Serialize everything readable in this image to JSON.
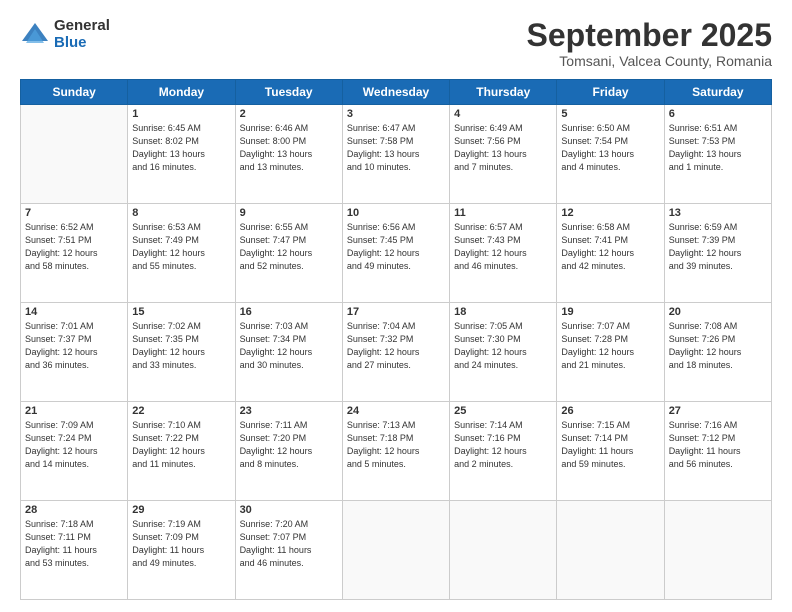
{
  "logo": {
    "general": "General",
    "blue": "Blue"
  },
  "header": {
    "month": "September 2025",
    "location": "Tomsani, Valcea County, Romania"
  },
  "weekdays": [
    "Sunday",
    "Monday",
    "Tuesday",
    "Wednesday",
    "Thursday",
    "Friday",
    "Saturday"
  ],
  "weeks": [
    [
      {
        "day": "",
        "info": ""
      },
      {
        "day": "1",
        "info": "Sunrise: 6:45 AM\nSunset: 8:02 PM\nDaylight: 13 hours\nand 16 minutes."
      },
      {
        "day": "2",
        "info": "Sunrise: 6:46 AM\nSunset: 8:00 PM\nDaylight: 13 hours\nand 13 minutes."
      },
      {
        "day": "3",
        "info": "Sunrise: 6:47 AM\nSunset: 7:58 PM\nDaylight: 13 hours\nand 10 minutes."
      },
      {
        "day": "4",
        "info": "Sunrise: 6:49 AM\nSunset: 7:56 PM\nDaylight: 13 hours\nand 7 minutes."
      },
      {
        "day": "5",
        "info": "Sunrise: 6:50 AM\nSunset: 7:54 PM\nDaylight: 13 hours\nand 4 minutes."
      },
      {
        "day": "6",
        "info": "Sunrise: 6:51 AM\nSunset: 7:53 PM\nDaylight: 13 hours\nand 1 minute."
      }
    ],
    [
      {
        "day": "7",
        "info": "Sunrise: 6:52 AM\nSunset: 7:51 PM\nDaylight: 12 hours\nand 58 minutes."
      },
      {
        "day": "8",
        "info": "Sunrise: 6:53 AM\nSunset: 7:49 PM\nDaylight: 12 hours\nand 55 minutes."
      },
      {
        "day": "9",
        "info": "Sunrise: 6:55 AM\nSunset: 7:47 PM\nDaylight: 12 hours\nand 52 minutes."
      },
      {
        "day": "10",
        "info": "Sunrise: 6:56 AM\nSunset: 7:45 PM\nDaylight: 12 hours\nand 49 minutes."
      },
      {
        "day": "11",
        "info": "Sunrise: 6:57 AM\nSunset: 7:43 PM\nDaylight: 12 hours\nand 46 minutes."
      },
      {
        "day": "12",
        "info": "Sunrise: 6:58 AM\nSunset: 7:41 PM\nDaylight: 12 hours\nand 42 minutes."
      },
      {
        "day": "13",
        "info": "Sunrise: 6:59 AM\nSunset: 7:39 PM\nDaylight: 12 hours\nand 39 minutes."
      }
    ],
    [
      {
        "day": "14",
        "info": "Sunrise: 7:01 AM\nSunset: 7:37 PM\nDaylight: 12 hours\nand 36 minutes."
      },
      {
        "day": "15",
        "info": "Sunrise: 7:02 AM\nSunset: 7:35 PM\nDaylight: 12 hours\nand 33 minutes."
      },
      {
        "day": "16",
        "info": "Sunrise: 7:03 AM\nSunset: 7:34 PM\nDaylight: 12 hours\nand 30 minutes."
      },
      {
        "day": "17",
        "info": "Sunrise: 7:04 AM\nSunset: 7:32 PM\nDaylight: 12 hours\nand 27 minutes."
      },
      {
        "day": "18",
        "info": "Sunrise: 7:05 AM\nSunset: 7:30 PM\nDaylight: 12 hours\nand 24 minutes."
      },
      {
        "day": "19",
        "info": "Sunrise: 7:07 AM\nSunset: 7:28 PM\nDaylight: 12 hours\nand 21 minutes."
      },
      {
        "day": "20",
        "info": "Sunrise: 7:08 AM\nSunset: 7:26 PM\nDaylight: 12 hours\nand 18 minutes."
      }
    ],
    [
      {
        "day": "21",
        "info": "Sunrise: 7:09 AM\nSunset: 7:24 PM\nDaylight: 12 hours\nand 14 minutes."
      },
      {
        "day": "22",
        "info": "Sunrise: 7:10 AM\nSunset: 7:22 PM\nDaylight: 12 hours\nand 11 minutes."
      },
      {
        "day": "23",
        "info": "Sunrise: 7:11 AM\nSunset: 7:20 PM\nDaylight: 12 hours\nand 8 minutes."
      },
      {
        "day": "24",
        "info": "Sunrise: 7:13 AM\nSunset: 7:18 PM\nDaylight: 12 hours\nand 5 minutes."
      },
      {
        "day": "25",
        "info": "Sunrise: 7:14 AM\nSunset: 7:16 PM\nDaylight: 12 hours\nand 2 minutes."
      },
      {
        "day": "26",
        "info": "Sunrise: 7:15 AM\nSunset: 7:14 PM\nDaylight: 11 hours\nand 59 minutes."
      },
      {
        "day": "27",
        "info": "Sunrise: 7:16 AM\nSunset: 7:12 PM\nDaylight: 11 hours\nand 56 minutes."
      }
    ],
    [
      {
        "day": "28",
        "info": "Sunrise: 7:18 AM\nSunset: 7:11 PM\nDaylight: 11 hours\nand 53 minutes."
      },
      {
        "day": "29",
        "info": "Sunrise: 7:19 AM\nSunset: 7:09 PM\nDaylight: 11 hours\nand 49 minutes."
      },
      {
        "day": "30",
        "info": "Sunrise: 7:20 AM\nSunset: 7:07 PM\nDaylight: 11 hours\nand 46 minutes."
      },
      {
        "day": "",
        "info": ""
      },
      {
        "day": "",
        "info": ""
      },
      {
        "day": "",
        "info": ""
      },
      {
        "day": "",
        "info": ""
      }
    ]
  ]
}
